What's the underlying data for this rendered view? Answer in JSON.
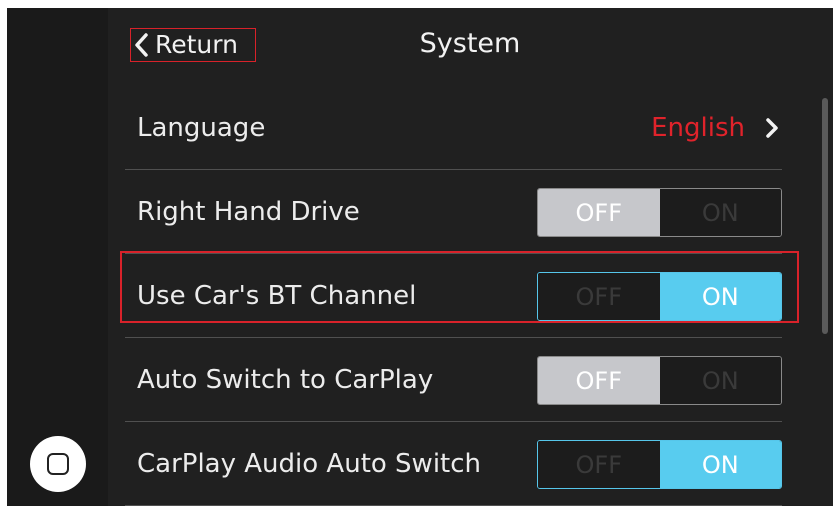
{
  "header": {
    "return_label": "Return",
    "title": "System"
  },
  "language": {
    "label": "Language",
    "value": "English",
    "value_color": "#e0232b"
  },
  "settings": [
    {
      "label": "Right Hand Drive",
      "state": "OFF",
      "off_label": "OFF",
      "on_label": "ON"
    },
    {
      "label": "Use Car's BT Channel",
      "state": "ON",
      "off_label": "OFF",
      "on_label": "ON"
    },
    {
      "label": "Auto Switch to CarPlay",
      "state": "OFF",
      "off_label": "OFF",
      "on_label": "ON"
    },
    {
      "label": "CarPlay Audio Auto Switch",
      "state": "ON",
      "off_label": "OFF",
      "on_label": "ON"
    }
  ],
  "colors": {
    "accent_on": "#58ccef",
    "highlight": "#d8222a"
  },
  "icons": {
    "back": "chevron-left-icon",
    "forward": "chevron-right-icon",
    "home": "home-button-icon"
  }
}
